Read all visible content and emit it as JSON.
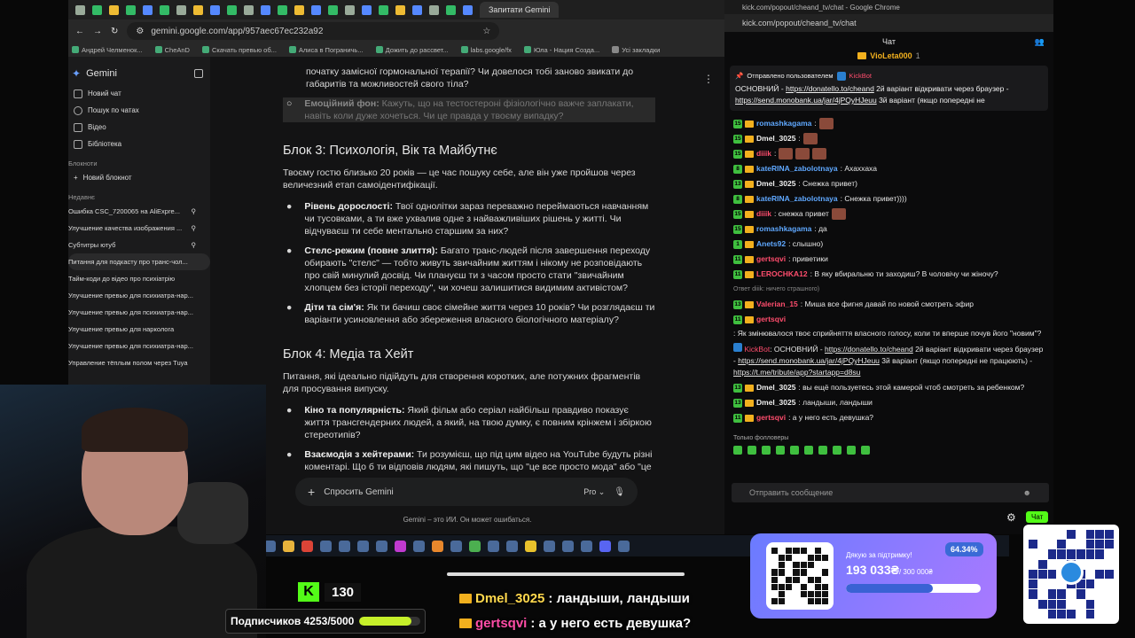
{
  "browser": {
    "tab_title": "Запитати Gemini",
    "url": "gemini.google.com/app/957aec67ec232a92",
    "bookmarks": [
      "Андрей Челменок...",
      "CheAnD",
      "Скачать превью об...",
      "Алиса в Пограничь...",
      "Дожить до рассвет...",
      "labs.google/fx",
      "Юла - Нация Созда...",
      "Усі закладки"
    ]
  },
  "gemini": {
    "app_name": "Gemini",
    "nav": [
      "Новий чат",
      "Пошук по чатах",
      "Відео",
      "Бібліотека"
    ],
    "notebooks_label": "Блокноти",
    "new_notebook": "Новий блокнот",
    "recent_label": "Недавнє",
    "recent": [
      "Ошибка CSC_7200065 на AliExpre...",
      "Улучшение качества изображения ...",
      "Субтитры ютуб",
      "Питання для подкасту про транс-чол...",
      "Тайм-коди до відео про психіатрію",
      "Улучшение превью для психиатра-нар...",
      "Улучшение превью для психиатра-нар...",
      "Улучшение превью для нарколога",
      "Улучшение превью для психиатра-нар...",
      "Управление тёплым полом через Tuya"
    ],
    "top_text": "початку замісної гормональної терапії? Чи довелося тобі заново звикати до габаритів та можливостей свого тіла?",
    "emo_label": "Емоційний фон:",
    "emo_text": " Кажуть, що на тестостероні фізіологічно важче заплакати, навіть коли дуже хочеться. Чи це правда у твоєму випадку?",
    "block3_title": "Блок 3: Психологія, Вік та Майбутнє",
    "block3_intro": "Твоєму гостю близько 20 років — це час пошуку себе, але він уже пройшов через величезний етап самоідентифікації.",
    "b3_1_label": "Рівень дорослості:",
    "b3_1_text": " Твої однолітки зараз переважно переймаються навчанням чи тусовками, а ти вже ухвалив одне з найважливіших рішень у житті. Чи відчуваєш ти себе ментально старшим за них?",
    "b3_2_label": "Стелс-режим (повне злиття):",
    "b3_2_text": " Багато транс-людей після завершення переходу обирають \"стелс\" — тобто живуть звичайним життям і нікому не розповідають про свій минулий досвід. Чи плануєш ти з часом просто стати \"звичайним хлопцем без історії переходу\", чи хочеш залишитися видимим активістом?",
    "b3_3_label": "Діти та сім'я:",
    "b3_3_text": " Як ти бачиш своє сімейне життя через 10 років? Чи розглядаєш ти варіанти усиновлення або збереження власного біологічного матеріалу?",
    "block4_title": "Блок 4: Медіа та Хейт",
    "block4_intro": "Питання, які ідеально підійдуть для створення коротких, але потужних фрагментів для просування випуску.",
    "b4_1_label": "Кіно та популярність:",
    "b4_1_text": " Який фільм або серіал найбільш правдиво показує життя трансгендерних людей, а який, на твою думку, є повним крінжем і збіркою стереотипів?",
    "b4_2_label": "Взаємодія з хейтерами:",
    "b4_2_text": " Ти розумієш, що під цим відео на YouTube будуть різні коментарі. Що б ти відповів людям, які пишуть, що \"це все просто мода\" або \"це",
    "ask_placeholder": "Спросить Gemini",
    "model": "Pro",
    "disclaimer": "Gemini – это ИИ. Он может ошибаться."
  },
  "kick": {
    "window_title": "kick.com/popout/cheand_tv/chat - Google Chrome",
    "url": "kick.com/popout/cheand_tv/chat",
    "header": "Чат",
    "top_user": "VioLeta000",
    "top_count": "1",
    "pinned_by": "Отправлено пользователем",
    "pinned_user": "KickBot",
    "pinned_text_1": "ОСНОВНИЙ - ",
    "pinned_link_1": "https://donatello.to/cheand",
    "pinned_text_2": " 2й варіант відкривати через браузер - ",
    "pinned_link_2": "https://send.monobank.ua/jar/4jPQyHJeuu",
    "pinned_text_3": " 3й варіант (якщо попередні не",
    "messages": [
      {
        "lvl": "15",
        "user": "romashkagama",
        "color": "#5fa8ff",
        "text": ":",
        "emotes": 1
      },
      {
        "lvl": "15",
        "user": "Dmel_3025",
        "color": "#f0f0f0",
        "text": ":",
        "emotes": 1
      },
      {
        "lvl": "15",
        "user": "diiik",
        "color": "#ff4d6d",
        "text": ":",
        "emotes": 3
      },
      {
        "lvl": "8",
        "user": "kateRINA_zabolotnaya",
        "color": "#5fa8ff",
        "text": ": Ахаххаха",
        "emotes": 0
      },
      {
        "lvl": "13",
        "user": "Dmel_3025",
        "color": "#f0f0f0",
        "text": ": Снежка привет)",
        "emotes": 0
      },
      {
        "lvl": "8",
        "user": "kateRINA_zabolotnaya",
        "color": "#5fa8ff",
        "text": ": Снежка привет))))",
        "emotes": 0
      },
      {
        "lvl": "15",
        "user": "diiik",
        "color": "#ff4d6d",
        "text": ": снежка привет",
        "emotes": 1
      },
      {
        "lvl": "15",
        "user": "romashkagama",
        "color": "#5fa8ff",
        "text": ": да",
        "emotes": 0
      },
      {
        "lvl": "1",
        "user": "Anets92",
        "color": "#5fa8ff",
        "text": ": слышно)",
        "emotes": 0
      },
      {
        "lvl": "11",
        "user": "gertsqvi",
        "color": "#ff4d6d",
        "text": ": приветики",
        "emotes": 0
      },
      {
        "lvl": "11",
        "user": "LEROCHKA12",
        "color": "#ff4d6d",
        "text": ": В яку вбиральню ти заходиш? В чоловічу чи жіночу?",
        "emotes": 0
      }
    ],
    "reply_hint": "Ответ diiik: ничего страшного)",
    "messages2": [
      {
        "lvl": "13",
        "user": "Valerian_15",
        "color": "#ff4d6d",
        "text": ": Миша все фигня давай по новой смотреть эфир"
      },
      {
        "lvl": "11",
        "user": "gertsqvi",
        "color": "#ff4d6d",
        "text": ": Як змінювалося твоє сприйняття власного голосу, коли ти вперше почув його \"новим\"?"
      }
    ],
    "bot_user": "KickBot",
    "bot_text_1": ": ОСНОВНИЙ - ",
    "bot_link_1": "https://donatello.to/cheand",
    "bot_text_2": " 2й варіант відкривати через браузер - ",
    "bot_link_2": "https://send.monobank.ua/jar/4jPQyHJeuu",
    "bot_text_3": " 3й варіант (якщо попередні не працюють) - ",
    "bot_link_3": "https://t.me/tribute/app?startapp=d8su",
    "messages3": [
      {
        "lvl": "13",
        "user": "Dmel_3025",
        "color": "#f0f0f0",
        "text": ": вы ещё пользуетесь этой камерой чтоб смотреть за ребенком?"
      },
      {
        "lvl": "13",
        "user": "Dmel_3025",
        "color": "#f0f0f0",
        "text": ": ландыши, ландыши"
      },
      {
        "lvl": "11",
        "user": "gertsqvi",
        "color": "#ff4d6d",
        "text": ": а у него есть девушка?"
      }
    ],
    "followers_only": "Только фолловеры",
    "composer_placeholder": "Отправить сообщение",
    "chat_button": "Чат"
  },
  "stream": {
    "kick_followers": "130",
    "subs_label": "Подписчиков 4253/5000",
    "subs_progress": 0.8506,
    "overlay_1_user": "Dmel_3025",
    "overlay_1_text": ": ландыши, ландыши",
    "overlay_2_user": "gertsqvi",
    "overlay_2_text": ": а у него есть девушка?"
  },
  "donation": {
    "title": "Дякую за підтримку!",
    "percent": "64.34%",
    "amount": "193 033₴",
    "goal": "/ 300 000₴",
    "progress": 0.6434
  },
  "colors": {
    "kick_green": "#53fc18",
    "gemini_bg": "#131314",
    "donation_bg": "#8a7bff"
  }
}
